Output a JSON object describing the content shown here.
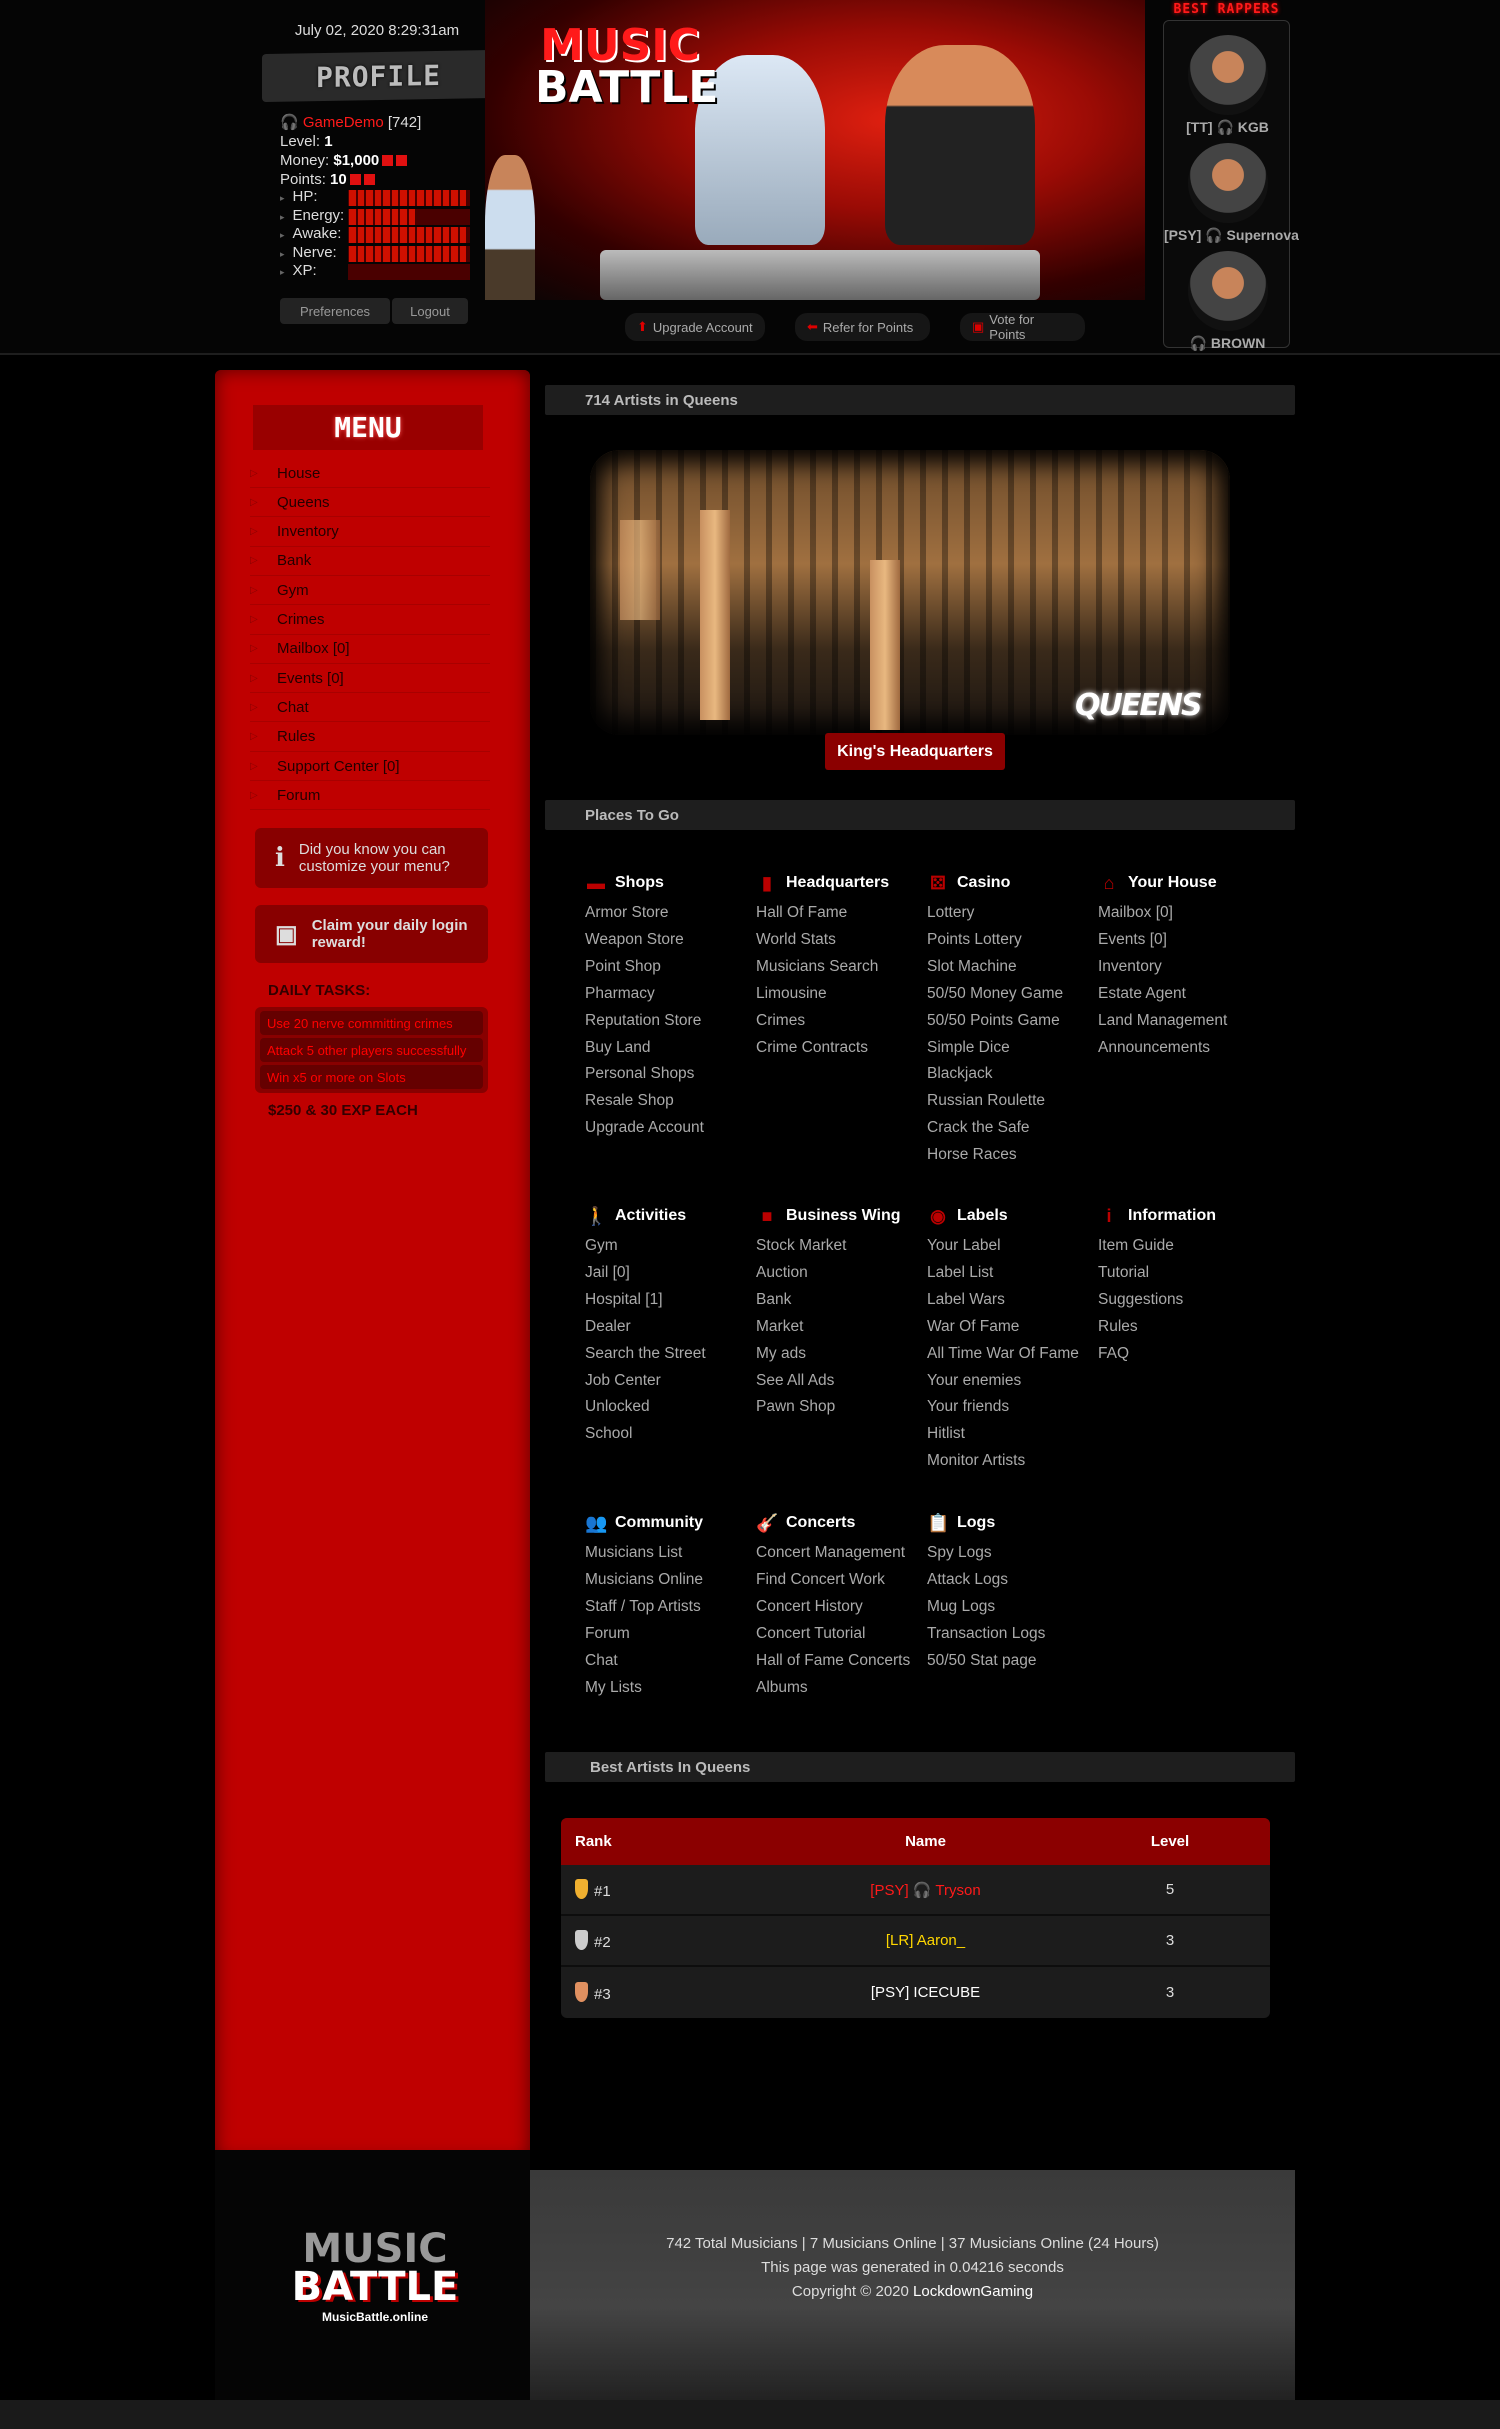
{
  "header": {
    "datetime": "July 02, 2020 8:29:31am",
    "profile_title": "PROFILE",
    "user": {
      "name": "GameDemo",
      "id_label": "[742]",
      "level_label": "Level:",
      "level": "1",
      "money_label": "Money:",
      "money": "$1,000",
      "points_label": "Points:",
      "points": "10"
    },
    "stats": [
      {
        "label": "HP:",
        "fill": 1.0
      },
      {
        "label": "Energy:",
        "fill": 0.6
      },
      {
        "label": "Awake:",
        "fill": 1.0
      },
      {
        "label": "Nerve:",
        "fill": 1.0
      },
      {
        "label": "XP:",
        "fill": 0.0
      }
    ],
    "buttons": {
      "preferences": "Preferences",
      "logout": "Logout"
    },
    "logo": {
      "line1": "MUSIC",
      "line2": "BATTLE"
    },
    "nav": [
      {
        "label": "Upgrade Account",
        "icon": "arrow-up-icon"
      },
      {
        "label": "Refer for Points",
        "icon": "refer-icon"
      },
      {
        "label": "Vote for Points",
        "icon": "vote-icon"
      }
    ],
    "best_rappers": {
      "title": "BEST RAPPERS",
      "items": [
        "[TT] 🎧 KGB",
        "[PSY] 🎧 Supernova",
        "🎧 BROWN"
      ]
    }
  },
  "sidebar": {
    "title": "MENU",
    "items": [
      "House",
      "Queens",
      "Inventory",
      "Bank",
      "Gym",
      "Crimes",
      "Mailbox [0]",
      "Events [0]",
      "Chat",
      "Rules",
      "Support Center [0]",
      "Forum"
    ],
    "tip": "Did you know you can customize your menu?",
    "claim": "Claim your daily login reward!",
    "tasks_title": "DAILY TASKS:",
    "tasks": [
      "Use 20 nerve committing crimes",
      "Attack 5 other players successfully",
      "Win x5 or more on Slots"
    ],
    "reward": "$250 & 30 EXP EACH"
  },
  "main": {
    "artists_header": "714 Artists in Queens",
    "city_tag": "QUEENS",
    "kings_button": "King's Headquarters",
    "places_header": "Places To Go",
    "categories": [
      {
        "title": "Shops",
        "icon": "store-icon",
        "glyph": "▬",
        "items": [
          "Armor Store",
          "Weapon Store",
          "Point Shop",
          "Pharmacy",
          "Reputation Store",
          "Buy Land",
          "Personal Shops",
          "Resale Shop",
          "Upgrade Account"
        ]
      },
      {
        "title": "Headquarters",
        "icon": "building-icon",
        "glyph": "▮",
        "items": [
          "Hall Of Fame",
          "World Stats",
          "Musicians Search",
          "Limousine",
          "Crimes",
          "Crime Contracts"
        ]
      },
      {
        "title": "Casino",
        "icon": "dice-icon",
        "glyph": "⚄",
        "items": [
          "Lottery",
          "Points Lottery",
          "Slot Machine",
          "50/50 Money Game",
          "50/50 Points Game",
          "Simple Dice",
          "Blackjack",
          "Russian Roulette",
          "Crack the Safe",
          "Horse Races"
        ]
      },
      {
        "title": "Your House",
        "icon": "home-icon",
        "glyph": "⌂",
        "items": [
          "Mailbox [0]",
          "Events [0]",
          "Inventory",
          "Estate Agent",
          "Land Management",
          "Announcements"
        ]
      },
      {
        "title": "Activities",
        "icon": "walking-icon",
        "glyph": "🚶",
        "items": [
          "Gym",
          "Jail [0]",
          "Hospital [1]",
          "Dealer",
          "Search the Street",
          "Job Center",
          "Unlocked",
          "School"
        ]
      },
      {
        "title": "Business Wing",
        "icon": "briefcase-icon",
        "glyph": "■",
        "items": [
          "Stock Market",
          "Auction",
          "Bank",
          "Market",
          "My ads",
          "See All Ads",
          "Pawn Shop"
        ]
      },
      {
        "title": "Labels",
        "icon": "target-icon",
        "glyph": "◉",
        "items": [
          "Your Label",
          "Label List",
          "Label Wars",
          "War Of Fame",
          "All Time War Of Fame",
          "Your enemies",
          "Your friends",
          "Hitlist",
          "Monitor Artists"
        ]
      },
      {
        "title": "Information",
        "icon": "info-icon",
        "glyph": "i",
        "items": [
          "Item Guide",
          "Tutorial",
          "Suggestions",
          "Rules",
          "FAQ"
        ]
      },
      {
        "title": "Community",
        "icon": "users-icon",
        "glyph": "👥",
        "items": [
          "Musicians List",
          "Musicians Online",
          "Staff / Top Artists",
          "Forum",
          "Chat",
          "My Lists"
        ]
      },
      {
        "title": "Concerts",
        "icon": "guitar-icon",
        "glyph": "🎸",
        "items": [
          "Concert Management",
          "Find Concert Work",
          "Concert History",
          "Concert Tutorial",
          "Hall of Fame Concerts",
          "Albums"
        ]
      },
      {
        "title": "Logs",
        "icon": "clipboard-icon",
        "glyph": "📋",
        "items": [
          "Spy Logs",
          "Attack Logs",
          "Mug Logs",
          "Transaction Logs",
          "50/50 Stat page"
        ]
      }
    ],
    "best_header": "Best Artists In Queens",
    "table": {
      "columns": [
        "Rank",
        "Name",
        "Level"
      ],
      "rows": [
        {
          "rank": "#1",
          "medal": "gold",
          "name": "[PSY] 🎧 Tryson",
          "name_color": "#ff1a1a",
          "level": "5"
        },
        {
          "rank": "#2",
          "medal": "silver",
          "name": "[LR] Aaron_",
          "name_color": "#ffd700",
          "level": "3"
        },
        {
          "rank": "#3",
          "medal": "bronze",
          "name": "[PSY] ICECUBE",
          "name_color": "#ffffff",
          "level": "3"
        }
      ]
    }
  },
  "footer": {
    "logo": {
      "line1": "MUSIC",
      "line2": "BATTLE",
      "url_text": "MusicBattle.online"
    },
    "stats": "742 Total Musicians | 7 Musicians Online | 37 Musicians Online (24 Hours)",
    "generated": "This page was generated in 0.04216 seconds",
    "copyright_prefix": "Copyright © 2020 ",
    "copyright_owner": "LockdownGaming"
  },
  "colors": {
    "accent": "#bf0000",
    "header_red": "#8b0000",
    "link": "#aaaaaa"
  }
}
